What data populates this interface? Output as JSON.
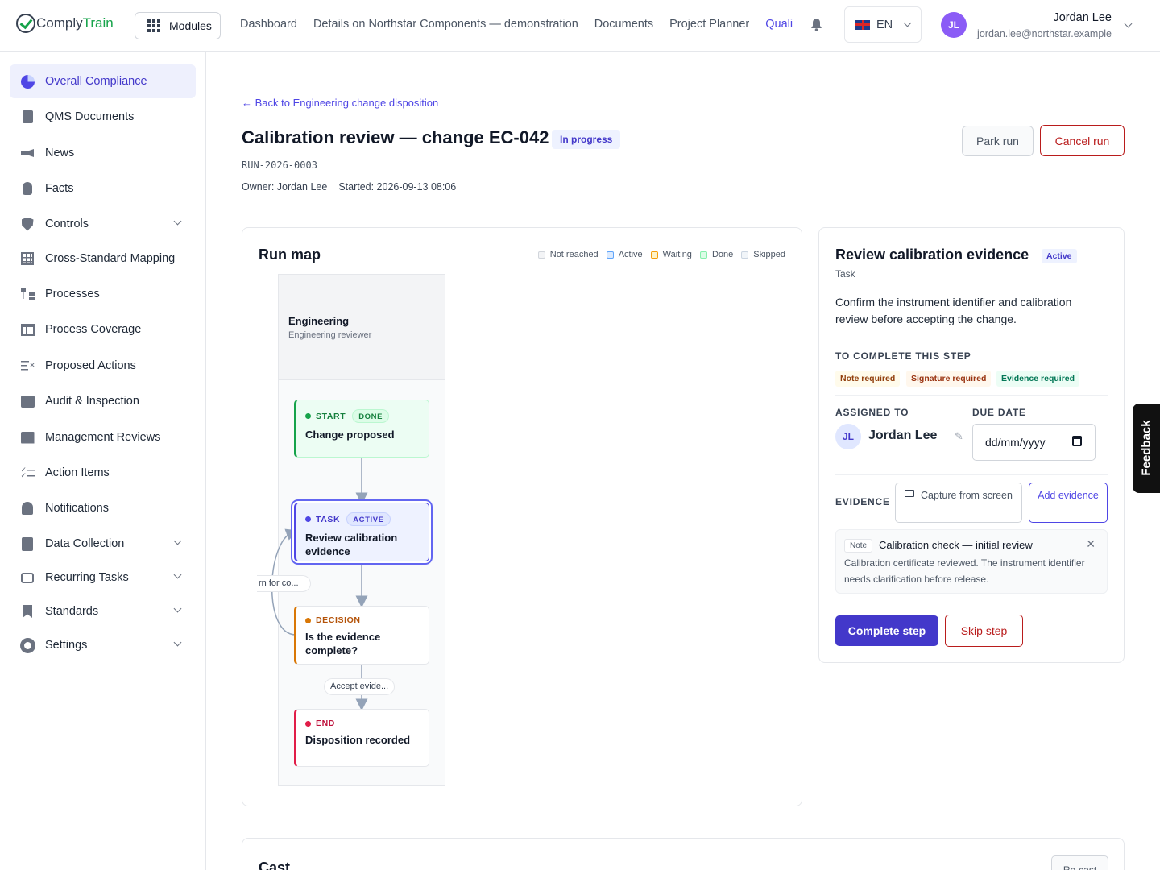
{
  "brand": {
    "part1": "Comply",
    "part2": "Train"
  },
  "topbar": {
    "modules_label": "Modules",
    "nav": [
      "Dashboard",
      "Details on Northstar Components — demonstration",
      "Documents",
      "Project Planner",
      "Quali"
    ],
    "active_nav": "Quali",
    "language": "EN",
    "user": {
      "initials": "JL",
      "name": "Jordan Lee",
      "email": "jordan.lee@northstar.example"
    }
  },
  "sidebar": {
    "items": [
      {
        "label": "Overall Compliance",
        "icon": "pie-chart-icon",
        "active": true
      },
      {
        "label": "QMS Documents",
        "icon": "document-icon"
      },
      {
        "label": "News",
        "icon": "megaphone-icon"
      },
      {
        "label": "Facts",
        "icon": "lightbulb-icon"
      },
      {
        "label": "Controls",
        "icon": "shield-icon",
        "expandable": true
      },
      {
        "label": "Cross-Standard Mapping",
        "icon": "grid-icon"
      },
      {
        "label": "Processes",
        "icon": "process-icon"
      },
      {
        "label": "Process Coverage",
        "icon": "table-icon"
      },
      {
        "label": "Proposed Actions",
        "icon": "list-x-icon"
      },
      {
        "label": "Audit & Inspection",
        "icon": "audit-icon"
      },
      {
        "label": "Management Reviews",
        "icon": "chart-icon"
      },
      {
        "label": "Action Items",
        "icon": "checklist-icon"
      },
      {
        "label": "Notifications",
        "icon": "bell-icon"
      },
      {
        "label": "Data Collection",
        "icon": "clipboard-icon",
        "expandable": true
      },
      {
        "label": "Recurring Tasks",
        "icon": "repeat-icon",
        "expandable": true
      },
      {
        "label": "Standards",
        "icon": "bookmark-icon",
        "expandable": true
      },
      {
        "label": "Settings",
        "icon": "gear-icon",
        "expandable": true
      }
    ]
  },
  "run": {
    "back_link": "← Back to Engineering change disposition",
    "title": "Calibration review — change EC-042",
    "status": "In progress",
    "id": "RUN-2026-0003",
    "owner": "Owner: Jordan Lee",
    "started": "Started: 2026-09-13 08:06",
    "park_label": "Park run",
    "cancel_label": "Cancel run"
  },
  "run_map": {
    "title": "Run map",
    "legend": [
      {
        "label": "Not reached",
        "color": "#f3f4f6",
        "border": "#d1d5db"
      },
      {
        "label": "Active",
        "color": "#dbeafe",
        "border": "#60a5fa"
      },
      {
        "label": "Waiting",
        "color": "#fef3c7",
        "border": "#f59e0b"
      },
      {
        "label": "Done",
        "color": "#dcfce7",
        "border": "#86efac"
      },
      {
        "label": "Skipped",
        "color": "#f1f5f9",
        "border": "#cbd5e1"
      }
    ],
    "lane": {
      "title": "Engineering",
      "subtitle": "Engineering reviewer"
    },
    "nodes": [
      {
        "kind": "START",
        "state": "DONE",
        "label": "Change proposed",
        "dot": "#16a34a",
        "kind_color": "#15803d"
      },
      {
        "kind": "TASK",
        "state": "ACTIVE",
        "label": "Review calibration evidence",
        "dot": "#4f46e5",
        "kind_color": "#4338ca"
      },
      {
        "kind": "DECISION",
        "state": "",
        "label": "Is the evidence complete?",
        "dot": "#d97706",
        "kind_color": "#b45309"
      },
      {
        "kind": "END",
        "state": "",
        "label": "Disposition recorded",
        "dot": "#e11d48",
        "kind_color": "#be123c"
      }
    ],
    "edge_labels": {
      "return": "rn for co...",
      "accept": "Accept evide..."
    }
  },
  "step_panel": {
    "title": "Review calibration evidence",
    "badge": "Active",
    "type": "Task",
    "description": "Confirm the instrument identifier and calibration review before accepting the change.",
    "requirements_heading": "TO COMPLETE THIS STEP",
    "requirements": [
      "Note required",
      "Signature required",
      "Evidence required"
    ],
    "assigned_heading": "ASSIGNED TO",
    "assignee": {
      "initials": "JL",
      "name": "Jordan Lee"
    },
    "due_heading": "DUE DATE",
    "due_placeholder": "dd/mm/yyyy",
    "evidence_heading": "EVIDENCE",
    "capture_label": "Capture from screen",
    "add_label": "Add evidence",
    "evidence_item": {
      "type": "Note",
      "title": "Calibration check — initial review",
      "text": "Calibration certificate reviewed. The instrument identifier needs clarification before release."
    },
    "complete_label": "Complete step",
    "skip_label": "Skip step"
  },
  "cast": {
    "title": "Cast",
    "recast_label": "Re-cast"
  },
  "feedback_label": "Feedback"
}
